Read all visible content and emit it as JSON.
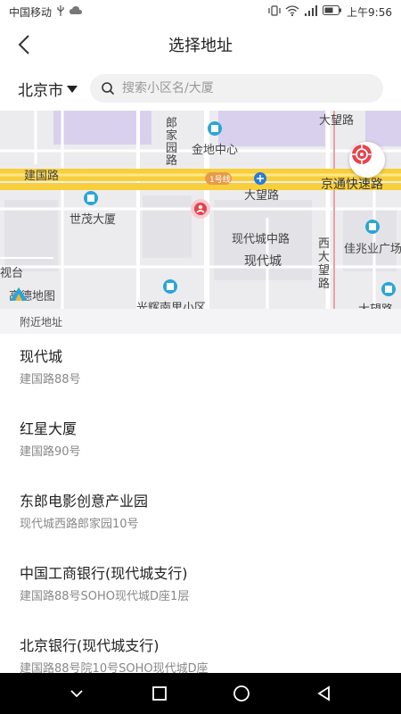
{
  "status_bar": {
    "carrier": "中国移动",
    "time": "上午9:56"
  },
  "header": {
    "title": "选择地址"
  },
  "search": {
    "city": "北京市",
    "placeholder": "搜索小区名/大厦"
  },
  "map": {
    "labels": [
      "大望路",
      "郎家园路",
      "金地中心",
      "建国路",
      "1号线",
      "大望路",
      "京通快速路",
      "世茂大厦",
      "现代城中路",
      "现代城",
      "西大望路",
      "佳兆业广场",
      "视台",
      "光辉南里小区",
      "大望路"
    ],
    "logo_text": "高德地图"
  },
  "nearby": {
    "section_title": "附近地址",
    "items": [
      {
        "name": "现代城",
        "address": "建国路88号"
      },
      {
        "name": "红星大厦",
        "address": "建国路90号"
      },
      {
        "name": "东郎电影创意产业园",
        "address": "现代城西路郎家园10号"
      },
      {
        "name": "中国工商银行(现代城支行)",
        "address": "建国路88号SOHO现代城D座1层"
      },
      {
        "name": "北京银行(现代城支行)",
        "address": "建国路88号院10号SOHO现代城D座"
      }
    ]
  },
  "colors": {
    "highway": "#f8cf3a",
    "accent": "#e8424a",
    "poi": "#2aa6d6"
  }
}
